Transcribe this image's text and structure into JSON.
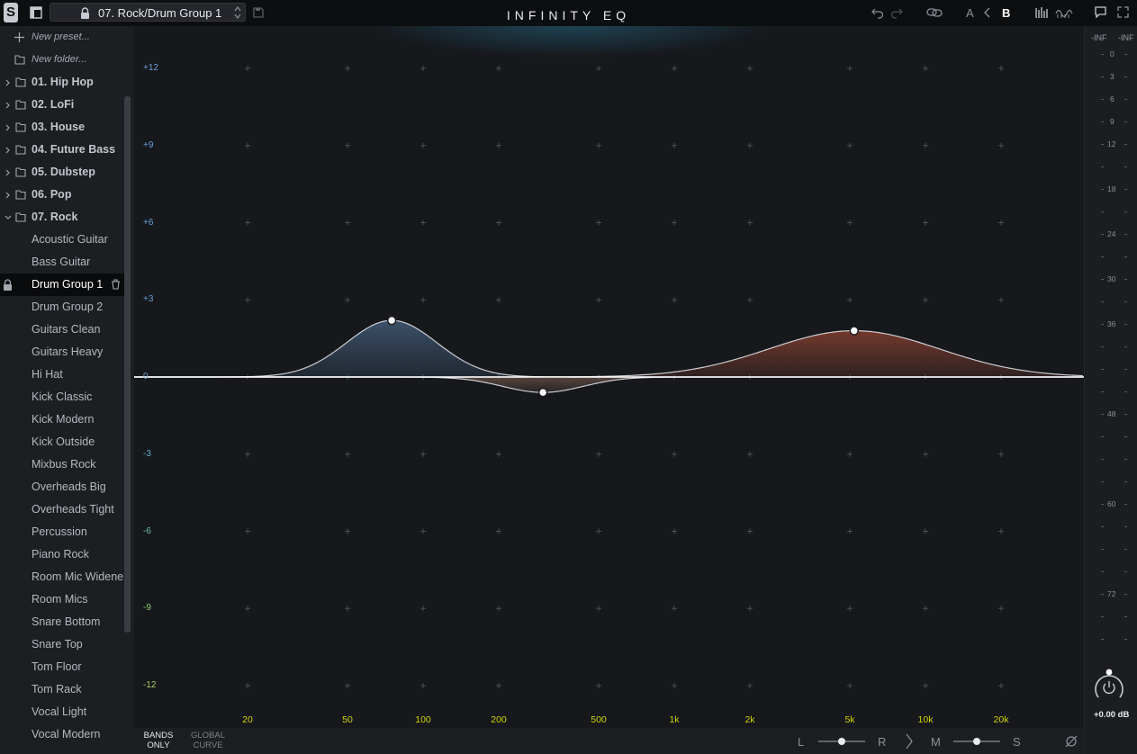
{
  "topbar": {
    "logo": "S",
    "preset_name": "07. Rock/Drum Group 1",
    "title": "INFINITY EQ",
    "ab_a": "A",
    "ab_b": "B",
    "icons": [
      "undo-icon",
      "redo-icon",
      "link-icon",
      "copy-ab-icon",
      "spectrum-icon",
      "piano-icon",
      "comment-icon",
      "fullscreen-icon"
    ]
  },
  "sidebar": {
    "actions": [
      {
        "label": "New preset...",
        "icon": "plus-icon"
      },
      {
        "label": "New folder...",
        "icon": "new-folder-icon"
      }
    ],
    "folders": [
      {
        "label": "01. Hip Hop",
        "expanded": false
      },
      {
        "label": "02. LoFi",
        "expanded": false
      },
      {
        "label": "03. House",
        "expanded": false
      },
      {
        "label": "04. Future Bass",
        "expanded": false
      },
      {
        "label": "05. Dubstep",
        "expanded": false
      },
      {
        "label": "06. Pop",
        "expanded": false
      },
      {
        "label": "07. Rock",
        "expanded": true
      }
    ],
    "presets": [
      "Acoustic Guitar",
      "Bass Guitar",
      "Drum Group 1",
      "Drum Group 2",
      "Guitars Clean",
      "Guitars Heavy",
      "Hi Hat",
      "Kick Classic",
      "Kick Modern",
      "Kick Outside",
      "Mixbus Rock",
      "Overheads Big",
      "Overheads Tight",
      "Percussion",
      "Piano Rock",
      "Room Mic Widener",
      "Room Mics",
      "Snare Bottom",
      "Snare Top",
      "Tom Floor",
      "Tom Rack",
      "Vocal Light",
      "Vocal Modern"
    ],
    "selected_preset": "Drum Group 1"
  },
  "graph": {
    "db_labels": [
      "+12",
      "+9",
      "+6",
      "+3",
      "0",
      "-3",
      "-6",
      "-9",
      "-12"
    ],
    "freq_labels": [
      "20",
      "50",
      "100",
      "200",
      "500",
      "1k",
      "2k",
      "5k",
      "10k",
      "20k"
    ],
    "bands": [
      {
        "freq_hz": 75,
        "gain_db": 2.2,
        "color": "#5b7fa8"
      },
      {
        "freq_hz": 300,
        "gain_db": -0.6,
        "color": "#8a6a5a"
      },
      {
        "freq_hz": 5200,
        "gain_db": 1.8,
        "color": "#c0553a"
      }
    ]
  },
  "bottombar": {
    "bands_only": "BANDS ONLY",
    "global_curve": "GLOBAL CURVE",
    "pan_left": "L",
    "pan_right": "R",
    "ms_mid": "M",
    "ms_side": "S"
  },
  "meter": {
    "peak_left": "-INF",
    "peak_right": "-INF",
    "scale": [
      "0",
      "3",
      "6",
      "9",
      "12",
      "18",
      "24",
      "30",
      "36",
      "48",
      "60",
      "72"
    ],
    "output_gain": "+0.00 dB"
  }
}
